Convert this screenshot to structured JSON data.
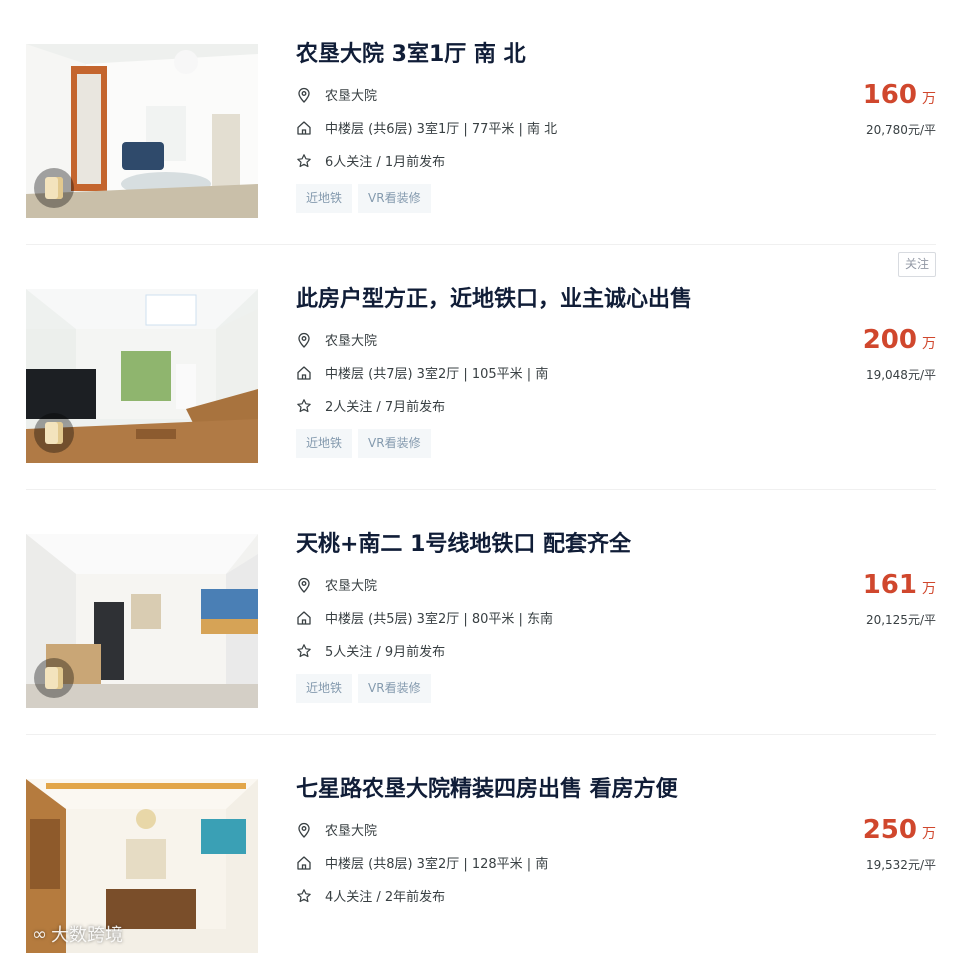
{
  "listings": [
    {
      "title": "农垦大院 3室1厅 南 北",
      "community": "农垦大院",
      "house_info": "中楼层 (共6层) 3室1厅 | 77平米 | 南 北",
      "follow_info": "6人关注 / 1月前发布",
      "tags": [
        "近地铁",
        "VR看装修"
      ],
      "price": "160",
      "price_unit": "万",
      "unit_price": "20,780元/平",
      "follow_button": ""
    },
    {
      "title": "此房户型方正，近地铁口，业主诚心出售",
      "community": "农垦大院",
      "house_info": "中楼层 (共7层) 3室2厅 | 105平米 | 南",
      "follow_info": "2人关注 / 7月前发布",
      "tags": [
        "近地铁",
        "VR看装修"
      ],
      "price": "200",
      "price_unit": "万",
      "unit_price": "19,048元/平",
      "follow_button": "关注"
    },
    {
      "title": "天桃+南二 1号线地铁口 配套齐全",
      "community": "农垦大院",
      "house_info": "中楼层 (共5层) 3室2厅 | 80平米 | 东南",
      "follow_info": "5人关注 / 9月前发布",
      "tags": [
        "近地铁",
        "VR看装修"
      ],
      "price": "161",
      "price_unit": "万",
      "unit_price": "20,125元/平",
      "follow_button": ""
    },
    {
      "title": "七星路农垦大院精装四房出售 看房方便",
      "community": "农垦大院",
      "house_info": "中楼层 (共8层) 3室2厅 | 128平米 | 南",
      "follow_info": "4人关注 / 2年前发布",
      "tags": [],
      "price": "250",
      "price_unit": "万",
      "unit_price": "19,532元/平",
      "follow_button": ""
    }
  ],
  "watermark": "大数跨境",
  "icons": {
    "location": "location-pin-icon",
    "house": "house-icon",
    "star": "star-icon",
    "vr": "vr-cube-icon"
  },
  "colors": {
    "price": "#d0472d",
    "title": "#101d37",
    "tag_bg": "#f4f7f9",
    "tag_text": "#849aae"
  }
}
